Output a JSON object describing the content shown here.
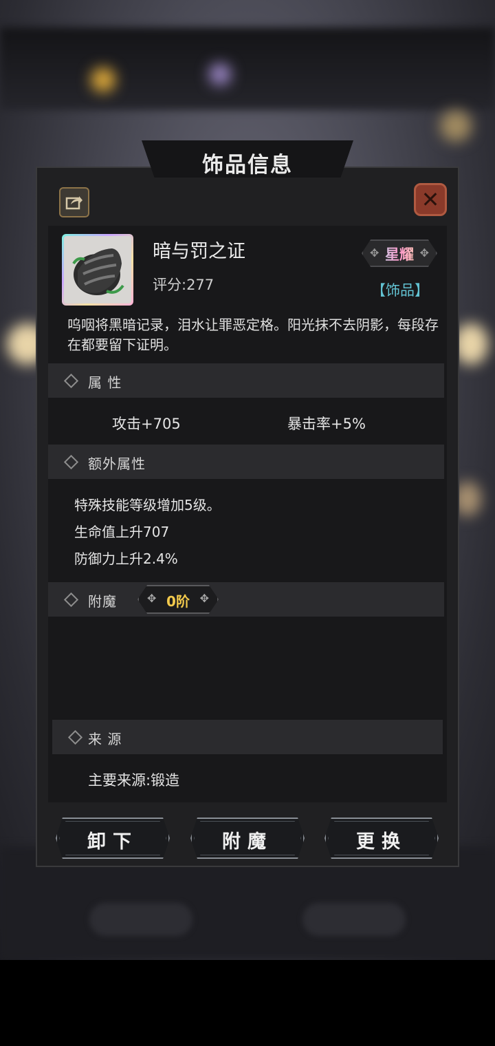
{
  "panel": {
    "title": "饰品信息"
  },
  "item": {
    "name": "暗与罚之证",
    "score": "评分:277",
    "rarity": "星耀",
    "type": "【饰品】",
    "description": "呜咽将黑暗记录，泪水让罪恶定格。阳光抹不去阴影，每段存在都要留下证明。"
  },
  "sections": {
    "attributes": {
      "label": "属 性",
      "attack": "攻击+705",
      "crit": "暴击率+5%"
    },
    "extra": {
      "label": "额外属性",
      "lines": [
        "特殊技能等级增加5级。",
        "生命值上升707",
        "防御力上升2.4%"
      ]
    },
    "enchant": {
      "label": "附魔",
      "tier": "0阶"
    },
    "source": {
      "label": "来 源",
      "text": "主要来源:锻造"
    }
  },
  "buttons": {
    "unequip": "卸下",
    "enchant": "附魔",
    "replace": "更换"
  },
  "icons": [
    "share-icon",
    "close-icon",
    "item-icon",
    "diamond-icon"
  ],
  "colors": {
    "panel_bg": "#202022",
    "item_type": "#62c2d2",
    "tier": "#f2c94c",
    "close": "#8a3a2a"
  }
}
